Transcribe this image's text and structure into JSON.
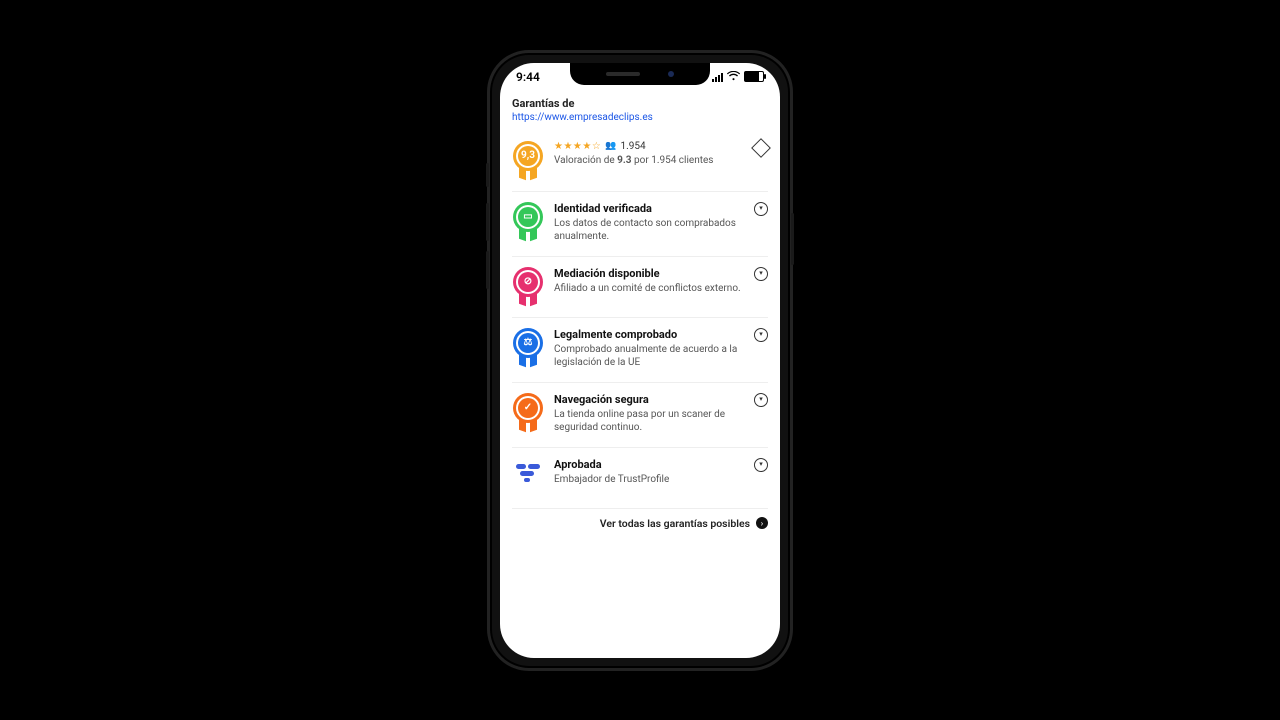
{
  "status": {
    "time": "9:44"
  },
  "header": {
    "label": "Garantías de",
    "url": "https://www.empresadeclips.es"
  },
  "items": [
    {
      "badge_text": "9,3",
      "stars_text": "★★★★☆",
      "count": "1.954",
      "desc_prefix": "Valoración de ",
      "score_bold": "9.3",
      "desc_suffix": " por 1.954 clientes"
    },
    {
      "glyph": "▭",
      "title": "Identidad verificada",
      "desc": "Los datos de contacto son comprabados anualmente."
    },
    {
      "glyph": "⊘",
      "title": "Mediación disponible",
      "desc": "Afiliado a un comité de conflictos externo."
    },
    {
      "glyph": "⚖",
      "title": "Legalmente comprobado",
      "desc": "Comprobado anualmente de acuerdo a la legislación de la UE"
    },
    {
      "glyph": "✓",
      "title": "Navegación segura",
      "desc": "La tienda online pasa por un scaner de seguridad continuo."
    },
    {
      "title": "Aprobada",
      "desc": "Embajador de TrustProfile"
    }
  ],
  "footer": {
    "label": "Ver todas las garantías posibles"
  }
}
